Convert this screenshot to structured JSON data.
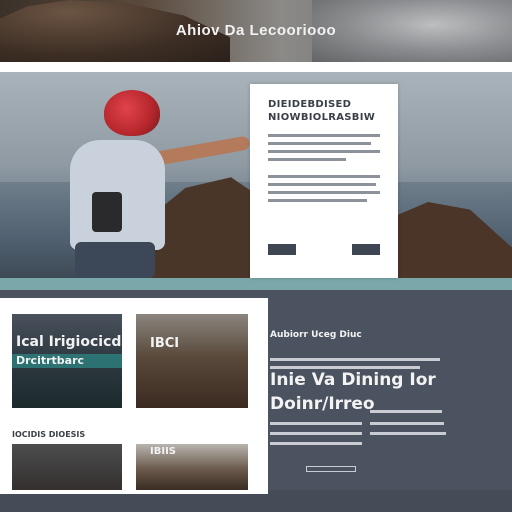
{
  "header": {
    "title": "Ahiov Da Lecooriooo"
  },
  "hero_card": {
    "heading_line1": "DIEIDEBDISED",
    "heading_line2": "NIOWBIOLRASBIW"
  },
  "gallery": {
    "thumb1_label1": "Ical Irigiocicde",
    "thumb1_label2": "Drcitrtbarc",
    "thumb2_label": "IBCI",
    "caption": "IOCIDIS DIOESIS",
    "thumb4_label": "IBIIS"
  },
  "info": {
    "kicker": "Aubiorr Uceg Diuc",
    "headline1": "Inie Va Dining Ior",
    "headline2": "Doinr/Irreo"
  },
  "colors": {
    "teal_accent": "#7aa8aa",
    "dark_panel": "#4b5360",
    "button_dark": "#3e4654"
  }
}
